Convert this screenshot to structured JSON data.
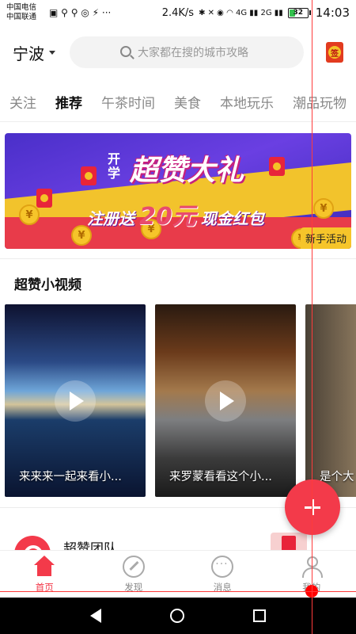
{
  "status_bar": {
    "carrier_1": "中国电信",
    "carrier_2": "中国联通",
    "icons": "▣ ⚲ ⚲ ◎ ⚡ ···",
    "net_speed": "2.4K/s",
    "right_icons": "✱ ✕ ◉ ◠ 4G ▮▮ 2G ▮▮",
    "battery": "32",
    "battery_level": 0.32,
    "time": "14:03"
  },
  "header": {
    "city": "宁波",
    "search_placeholder": "大家都在搜的城市攻略",
    "checkin_icon": "签"
  },
  "tabs": [
    "关注",
    "推荐",
    "午茶时间",
    "美食",
    "本地玩乐",
    "潮品玩物"
  ],
  "active_tab": "推荐",
  "banner": {
    "title_prefix": "开学",
    "title": "超赞大礼",
    "sub_a": "注册送",
    "sub_amount": "20元",
    "sub_b": "现金红包",
    "badge": "新手活动",
    "coin_symbol": "¥"
  },
  "videos": {
    "section_title": "超赞小视频",
    "items": [
      {
        "caption": "来来来一起来看小..."
      },
      {
        "caption": "来罗蒙看看这个小..."
      },
      {
        "caption": "是个大"
      }
    ]
  },
  "team": {
    "name": "超赞团队"
  },
  "bottom_nav": [
    {
      "label": "首页",
      "icon": "home-icon"
    },
    {
      "label": "发现",
      "icon": "compass-icon"
    },
    {
      "label": "消息",
      "icon": "chat-icon"
    },
    {
      "label": "我的",
      "icon": "user-icon"
    }
  ],
  "colors": {
    "accent": "#f33a4a",
    "banner_purple": "#4a2fc9",
    "banner_yellow": "#f6c52a"
  }
}
